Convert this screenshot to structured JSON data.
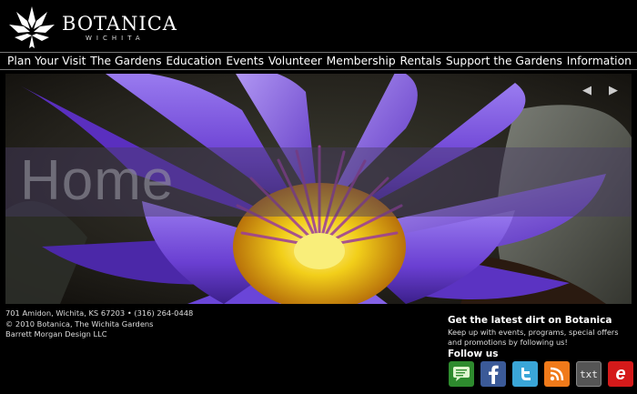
{
  "brand": {
    "name": "BOTANICA",
    "sublabel": "WICHITA"
  },
  "nav": {
    "items": [
      {
        "label": "Plan Your Visit"
      },
      {
        "label": "The Gardens"
      },
      {
        "label": "Education"
      },
      {
        "label": "Events"
      },
      {
        "label": "Volunteer"
      },
      {
        "label": "Membership"
      },
      {
        "label": "Rentals"
      },
      {
        "label": "Support the Gardens"
      },
      {
        "label": "Information"
      }
    ]
  },
  "hero": {
    "title": "Home",
    "prev_icon": "triangle-left",
    "next_icon": "triangle-right"
  },
  "footer": {
    "address": "701 Amidon, Wichita, KS 67203  •  (316) 264-0448",
    "copyright": "© 2010 Botanica, The Wichita Gardens",
    "credit": "Barrett Morgan Design LLC"
  },
  "newsletter": {
    "title": "Get the latest dirt on Botanica",
    "text": "Keep up with events, programs, special offers and promotions by following us!",
    "follow_label": "Follow us"
  },
  "social": {
    "items": [
      {
        "name": "chat",
        "color": "#2e8b2e"
      },
      {
        "name": "facebook",
        "color": "#3b5a98"
      },
      {
        "name": "twitter",
        "color": "#3aa6d8"
      },
      {
        "name": "rss",
        "color": "#f07a1a"
      },
      {
        "name": "txt",
        "label": "txt",
        "color": "#555555"
      },
      {
        "name": "email",
        "label": "e",
        "color": "#d41a1a"
      }
    ]
  },
  "colors": {
    "background": "#000000",
    "text": "#ffffff",
    "petal": "#7b52d8",
    "stamen": "#f2d21a"
  }
}
